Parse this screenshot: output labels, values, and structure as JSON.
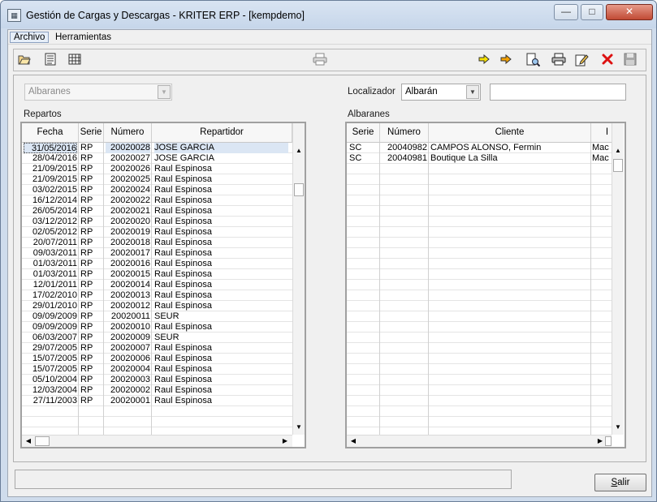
{
  "window": {
    "title": "Gestión de Cargas y Descargas - KRITER ERP -  [kempdemo]",
    "minimize_icon": "minimize-icon",
    "maximize_icon": "maximize-icon",
    "close_icon": "close-icon"
  },
  "menu": [
    "Archivo",
    "Herramientas"
  ],
  "toolbar": {
    "left_icons": [
      "open-folder-icon",
      "form-view-icon",
      "grid-view-icon"
    ],
    "center_icons": [
      "print-preview-icon"
    ],
    "right_icons": [
      "arrow-right-icon",
      "arrow-double-icon",
      "document-search-icon",
      "print-icon",
      "edit-icon",
      "delete-icon",
      "save-icon"
    ]
  },
  "filters": {
    "type_combo": "Albaranes",
    "localizador_label": "Localizador",
    "localizador_combo": "Albarán",
    "localizador_value": ""
  },
  "repartos": {
    "title": "Repartos",
    "columns": [
      "Fecha",
      "Serie",
      "Número",
      "Repartidor"
    ],
    "rows": [
      [
        "31/05/2016",
        "RP",
        "20020028",
        "JOSE GARCIA"
      ],
      [
        "28/04/2016",
        "RP",
        "20020027",
        "JOSE GARCIA"
      ],
      [
        "21/09/2015",
        "RP",
        "20020026",
        "Raul Espinosa"
      ],
      [
        "21/09/2015",
        "RP",
        "20020025",
        "Raul Espinosa"
      ],
      [
        "03/02/2015",
        "RP",
        "20020024",
        "Raul Espinosa"
      ],
      [
        "16/12/2014",
        "RP",
        "20020022",
        "Raul Espinosa"
      ],
      [
        "26/05/2014",
        "RP",
        "20020021",
        "Raul Espinosa"
      ],
      [
        "03/12/2012",
        "RP",
        "20020020",
        "Raul Espinosa"
      ],
      [
        "02/05/2012",
        "RP",
        "20020019",
        "Raul Espinosa"
      ],
      [
        "20/07/2011",
        "RP",
        "20020018",
        "Raul Espinosa"
      ],
      [
        "09/03/2011",
        "RP",
        "20020017",
        "Raul Espinosa"
      ],
      [
        "01/03/2011",
        "RP",
        "20020016",
        "Raul Espinosa"
      ],
      [
        "01/03/2011",
        "RP",
        "20020015",
        "Raul Espinosa"
      ],
      [
        "12/01/2011",
        "RP",
        "20020014",
        "Raul Espinosa"
      ],
      [
        "17/02/2010",
        "RP",
        "20020013",
        "Raul Espinosa"
      ],
      [
        "29/01/2010",
        "RP",
        "20020012",
        "Raul Espinosa"
      ],
      [
        "09/09/2009",
        "RP",
        "20020011",
        "SEUR"
      ],
      [
        "09/09/2009",
        "RP",
        "20020010",
        "Raul Espinosa"
      ],
      [
        "06/03/2007",
        "RP",
        "20020009",
        "SEUR"
      ],
      [
        "29/07/2005",
        "RP",
        "20020007",
        "Raul Espinosa"
      ],
      [
        "15/07/2005",
        "RP",
        "20020006",
        "Raul Espinosa"
      ],
      [
        "15/07/2005",
        "RP",
        "20020004",
        "Raul Espinosa"
      ],
      [
        "05/10/2004",
        "RP",
        "20020003",
        "Raul Espinosa"
      ],
      [
        "12/03/2004",
        "RP",
        "20020002",
        "Raul Espinosa"
      ],
      [
        "27/11/2003",
        "RP",
        "20020001",
        "Raul Espinosa"
      ]
    ]
  },
  "albaranes": {
    "title": "Albaranes",
    "columns": [
      "Serie",
      "Número",
      "Cliente",
      "I"
    ],
    "rows": [
      [
        "SC",
        "20040982",
        "CAMPOS ALONSO, Fermin",
        "Mac"
      ],
      [
        "SC",
        "20040981",
        "Boutique La Silla",
        "Mac"
      ]
    ]
  },
  "footer": {
    "status_text": "",
    "salir_label": "Salir",
    "salir_hotkey": "S",
    "salir_rest": "alir"
  }
}
